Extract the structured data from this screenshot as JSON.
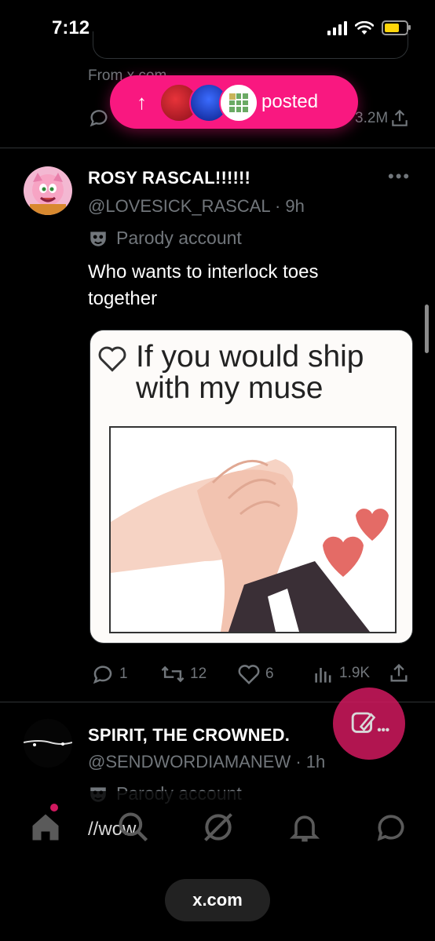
{
  "status_bar": {
    "time": "7:12",
    "battery_color": "#ffd60a"
  },
  "top_tweet": {
    "from_text": "From x.com",
    "views": "3.2M"
  },
  "posted_pill": {
    "label": "posted",
    "color": "#f91880"
  },
  "tweet": {
    "display_name": "ROSY RASCAL!!!!!!",
    "handle_time": "@LOVESICK_RASCAL · 9h",
    "parody_label": "Parody account",
    "text_line1": "Who wants to interlock toes",
    "text_line2": "together",
    "media_caption_line1": "If you would ship",
    "media_caption_line2": "with my muse",
    "replies": "1",
    "reposts": "12",
    "likes": "6",
    "views": "1.9K"
  },
  "next_tweet": {
    "display_name": "SPIRIT, THE CROWNED.",
    "handle_time": "@SENDWORDIAMANEW · 1h",
    "parody_label": "Parody account",
    "text": "//wow"
  },
  "browser": {
    "url": "x.com"
  }
}
